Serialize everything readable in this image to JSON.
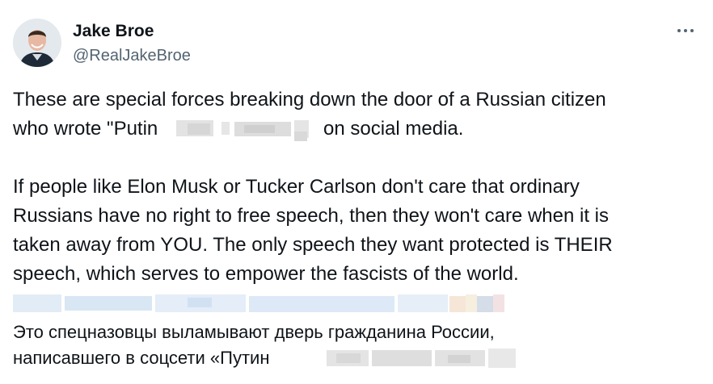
{
  "author": {
    "name": "Jake Broe",
    "handle": "@RealJakeBroe",
    "avatar_icon": "profile-photo"
  },
  "more_icon": "more-horizontal-icon",
  "tweet": {
    "lines": [
      "These are special forces breaking down the door of a Russian citizen",
      "who wrote \"Putin",
      "on social media.",
      "If people like Elon Musk or Tucker Carlson don't care that ordinary",
      "Russians have no right to free speech, then they won't care when it is",
      "taken away from YOU.  The only speech they want protected is THEIR",
      "speech, which serves to empower the fascists of the world."
    ]
  },
  "translation": {
    "lines": [
      "Это спецназовцы выламывают дверь гражданина России,",
      "написавшего в соцсети «Путин"
    ]
  },
  "colors": {
    "text": "#0f1419",
    "secondary": "#536471",
    "blur_gray": "#dcdcdc",
    "blur_blue": "#dbe8f6"
  }
}
